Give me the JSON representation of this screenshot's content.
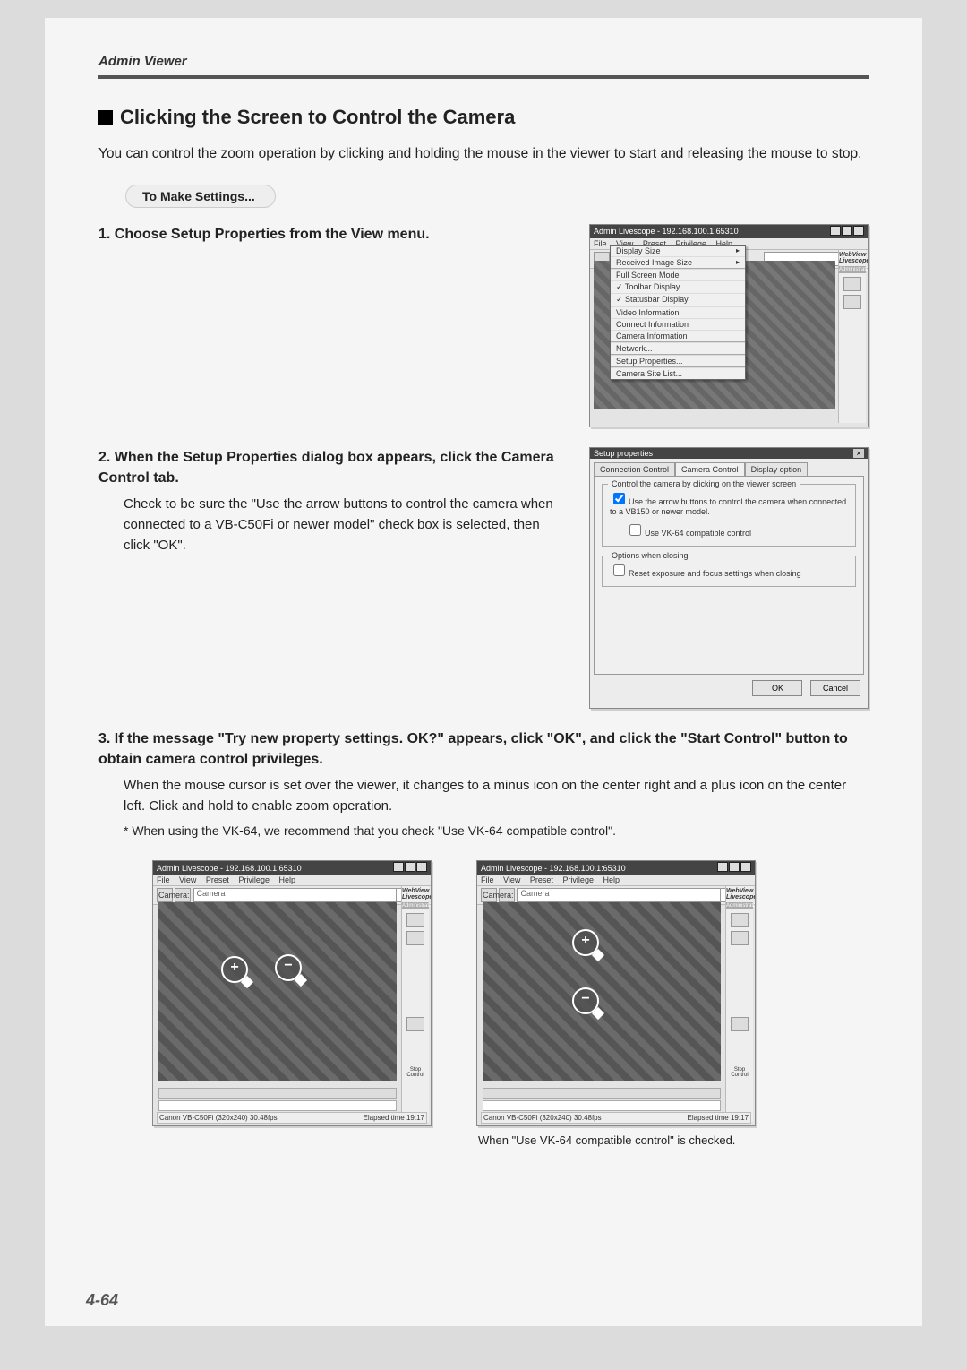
{
  "header": {
    "title": "Admin Viewer"
  },
  "section": {
    "title": "Clicking the Screen to Control the Camera",
    "intro": "You can control the zoom operation by clicking and holding the mouse in the viewer to start and releasing the mouse to stop."
  },
  "pill": {
    "label": "To Make Settings..."
  },
  "steps": {
    "s1": {
      "num": "1.",
      "title": "Choose Setup Properties from the View menu."
    },
    "s2": {
      "num": "2.",
      "title": "When the Setup Properties dialog box appears, click the Camera Control tab.",
      "body": "Check to be sure the \"Use the arrow buttons to control the camera when connected to a VB-C50Fi or newer model\" check box is selected, then click \"OK\"."
    },
    "s3": {
      "num": "3.",
      "title": "If the message \"Try new property settings. OK?\" appears, click \"OK\", and click the \"Start Control\" button to obtain camera control privileges.",
      "body": "When the mouse cursor is set over the viewer, it changes to a minus icon on the center right and a plus icon on the center left. Click and hold to enable zoom operation.",
      "note": "* When using the VK-64, we recommend that you check \"Use VK-64 compatible control\"."
    }
  },
  "shot_livescope": {
    "title": "Admin Livescope - 192.168.100.1:65310",
    "menubar": {
      "file": "File",
      "view": "View",
      "preset": "Preset",
      "privilege": "Privilege",
      "help": "Help"
    },
    "viewmenu": {
      "display_size": "Display Size",
      "received_size": "Received Image Size",
      "fullscreen": "Full Screen Mode",
      "toolbar": "Toolbar Display",
      "statusbar": "Statusbar Display",
      "video_info": "Video Information",
      "connect_info": "Connect Information",
      "camera_info": "Camera Information",
      "network": "Network...",
      "setup_props": "Setup Properties...",
      "site_list": "Camera Site List..."
    },
    "side": {
      "logo": "WebView Livescope",
      "admin": "Administrator"
    }
  },
  "shot_dialog": {
    "title": "Setup properties",
    "tabs": {
      "t1": "Connection Control",
      "t2": "Camera Control",
      "t3": "Display option"
    },
    "group1": {
      "title": "Control the camera by clicking on the viewer screen",
      "opt1": "Use the arrow buttons to control the camera when connected to a VB150 or newer model.",
      "opt2": "Use VK-64 compatible control"
    },
    "group2": {
      "title": "Options when closing",
      "opt1": "Reset exposure and focus settings when closing"
    },
    "buttons": {
      "ok": "OK",
      "cancel": "Cancel"
    }
  },
  "shot_viewer": {
    "title": "Admin Livescope - 192.168.100.1:65310",
    "menubar": {
      "file": "File",
      "view": "View",
      "preset": "Preset",
      "privilege": "Privilege",
      "help": "Help"
    },
    "camera_label": "Camera:",
    "camera_value": "Camera",
    "side": {
      "logo": "WebView Livescope",
      "admin": "Administrator",
      "stop": "Stop Control"
    },
    "status_left": "Canon VB-C50Fi (320x240) 30.48fps",
    "status_right": "Elapsed time 19:17"
  },
  "bottom_caption": "When \"Use VK-64 compatible control\" is checked.",
  "page_number": "4-64"
}
